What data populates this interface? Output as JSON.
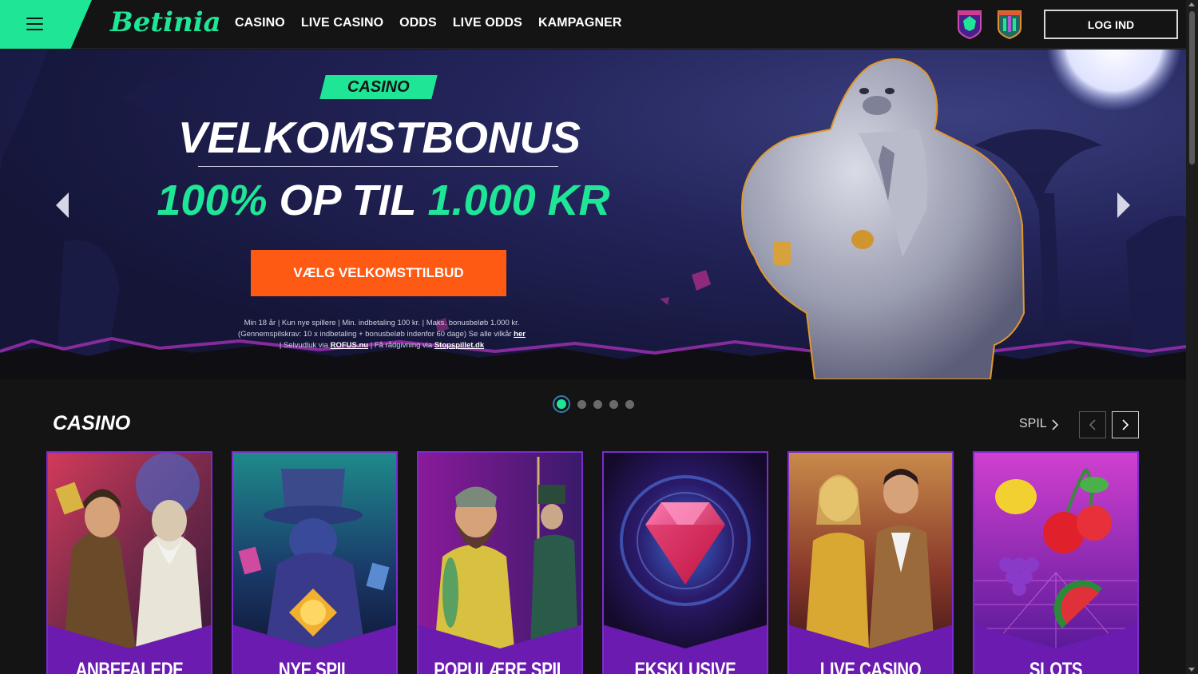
{
  "header": {
    "logo": "Betinia",
    "nav": [
      "CASINO",
      "LIVE CASINO",
      "ODDS",
      "LIVE ODDS",
      "KAMPAGNER"
    ],
    "login_label": "LOG IND",
    "badge_icons": [
      "spillemyndigheden-badge-icon",
      "stadium-badge-icon"
    ]
  },
  "hero": {
    "tag": "CASINO",
    "title": "VELKOMSTBONUS",
    "offer_percent": "100%",
    "offer_mid": " OP TIL ",
    "offer_amount": "1.000 KR",
    "cta": "VÆLG VELKOMSTTILBUD",
    "terms_line1": "Min 18 år | Kun nye spillere | Min. indbetaling 100 kr. | Maks. bonusbeløb 1.000 kr.",
    "terms_line2": "(Gennemspilskrav: 10 x indbetaling + bonusbeløb indenfor 60 dage) Se alle vilkår ",
    "terms_link_her": "her",
    "terms_line3a": "| Selvudluk via ",
    "terms_link_rofus": "ROFUS.nu",
    "terms_line3b": " | Få rådgivning via ",
    "terms_link_stop": "Stopspillet.dk",
    "slide_count": 5,
    "active_slide": 1
  },
  "casino_section": {
    "title": "CASINO",
    "spil_label": "SPIL",
    "cards": [
      {
        "label": "ANBEFALEDE SPIL"
      },
      {
        "label": "NYE SPIL"
      },
      {
        "label": "POPULÆRE SPIL"
      },
      {
        "label": "EKSKLUSIVE SPIL"
      },
      {
        "label": "LIVE CASINO"
      },
      {
        "label": "SLOTS"
      }
    ]
  },
  "colors": {
    "brand_green": "#1fe597",
    "cta_orange": "#ff5a13",
    "card_purple": "#6b1bb0",
    "background": "#141414"
  }
}
